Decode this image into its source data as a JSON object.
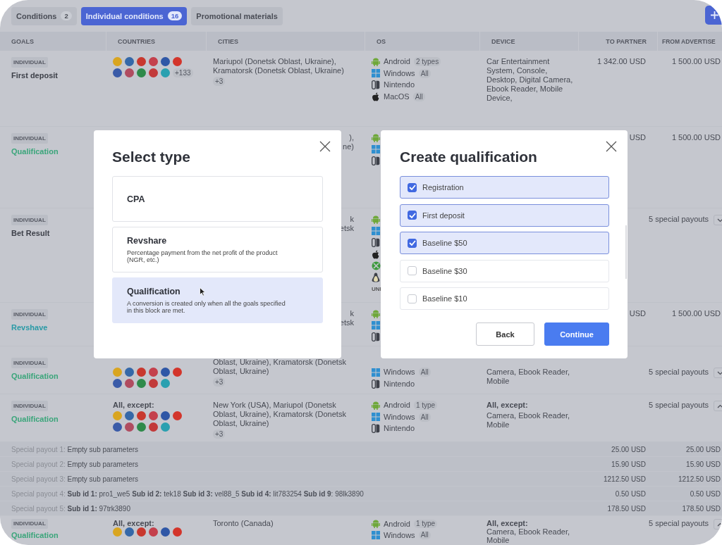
{
  "tabs": [
    {
      "label": "Conditions",
      "count": "2",
      "selected": false
    },
    {
      "label": "Individual conditions",
      "count": "16",
      "selected": true
    },
    {
      "label": "Promotional materials",
      "selected": false
    }
  ],
  "table": {
    "columns": [
      "GOALS",
      "COUNTRIES",
      "CITIES",
      "OS",
      "DEVICE",
      "TO PARTNER",
      "FROM ADVERTISE"
    ],
    "rows": [
      {
        "badge": "INDIVIDUAL",
        "goal": {
          "name": "First deposit",
          "color": "#3d4049"
        },
        "countries": {
          "flags": [
            {
              "color": "#d9a520"
            },
            {
              "color": "#3568a8"
            },
            {
              "color": "#c8382e"
            },
            {
              "color": "#c4404c"
            },
            {
              "color": "#2f57a6"
            },
            {
              "color": "#d3352b"
            },
            {
              "color": "#3a5ba8"
            },
            {
              "color": "#b04c60"
            },
            {
              "color": "#2f8a4a"
            },
            {
              "color": "#c23a3a"
            },
            {
              "color": "#2aa0b0"
            }
          ],
          "more": "+133"
        },
        "cities": {
          "kind": "full",
          "text": "Mariupol (Donetsk Oblast, Ukraine), Kramatorsk (Donetsk Oblast, Ukraine)",
          "more": "+3"
        },
        "os": [
          {
            "kind": "android",
            "name": "Android",
            "tag": "2 types"
          },
          {
            "kind": "windows",
            "name": "Windows",
            "tag": "All"
          },
          {
            "kind": "nintendo",
            "name": "Nintendo"
          },
          {
            "kind": "apple",
            "name": "MacOS",
            "tag": "All"
          }
        ],
        "device": {
          "text": "Car Entertainment System, Console, Desktop, Digital Camera, Ebook Reader, Mobile Device,"
        },
        "to_partner": "1 342.00 USD",
        "from_advertiser": "1 500.00 USD"
      },
      {
        "badge": "INDIVIDUAL",
        "goal": {
          "name": "Qualification",
          "color": "#3aa57a"
        },
        "cities": {
          "kind": "partial",
          "lines": [
            "),",
            "ne)"
          ]
        },
        "os": [
          {
            "kind": "android"
          },
          {
            "kind": "windows"
          },
          {
            "kind": "nintendo"
          }
        ],
        "to_partner": "USD",
        "from_advertiser": "1 500.00 USD"
      },
      {
        "badge": "INDIVIDUAL",
        "goal": {
          "name": "Bet Result",
          "color": "#3d4049"
        },
        "cities": {
          "kind": "partial",
          "lines": [
            "k",
            "etsk"
          ]
        },
        "os": [
          {
            "kind": "android"
          },
          {
            "kind": "windows"
          },
          {
            "kind": "nintendo"
          },
          {
            "kind": "apple"
          },
          {
            "kind": "xbox"
          },
          {
            "kind": "linux"
          },
          {
            "kind": "unix",
            "name": "UNI"
          }
        ],
        "payouts": {
          "text": "5 special payouts",
          "expanded": false
        }
      },
      {
        "badge": "INDIVIDUAL",
        "goal": {
          "name": "Revshave",
          "color": "#2a9aa6"
        },
        "cities": {
          "kind": "partial",
          "lines": [
            "k",
            "etsk"
          ]
        },
        "os": [
          {
            "kind": "android"
          },
          {
            "kind": "windows"
          },
          {
            "kind": "nintendo"
          }
        ],
        "to_partner": "USD",
        "from_advertiser": "1 500.00 USD"
      },
      {
        "badge": "INDIVIDUAL",
        "goal": {
          "name": "Qualification",
          "color": "#3aa57a"
        },
        "countries": {
          "flags": [
            {
              "color": "#d9a520"
            },
            {
              "color": "#3568a8"
            },
            {
              "color": "#c8382e"
            },
            {
              "color": "#c4404c"
            },
            {
              "color": "#2f57a6"
            },
            {
              "color": "#d3352b"
            },
            {
              "color": "#3a5ba8"
            },
            {
              "color": "#b04c60"
            },
            {
              "color": "#2f8a4a"
            },
            {
              "color": "#c23a3a"
            },
            {
              "color": "#2aa0b0"
            }
          ]
        },
        "cities": {
          "kind": "full",
          "text": "Oblast, Ukraine), Kramatorsk (Donetsk Oblast, Ukraine)",
          "more": "+3"
        },
        "os": [
          {
            "kind": "windows",
            "name": "Windows",
            "tag": "All"
          },
          {
            "kind": "nintendo",
            "name": "Nintendo"
          }
        ],
        "device": {
          "text": "Camera, Ebook Reader, Mobile"
        },
        "payouts": {
          "text": "5 special payouts",
          "expanded": false
        }
      },
      {
        "badge": "INDIVIDUAL",
        "goal": {
          "name": "Qualification",
          "color": "#3aa57a"
        },
        "countries": {
          "label": "All, except:",
          "flags": [
            {
              "color": "#d9a520"
            },
            {
              "color": "#3568a8"
            },
            {
              "color": "#c8382e"
            },
            {
              "color": "#c4404c"
            },
            {
              "color": "#2f57a6"
            },
            {
              "color": "#d3352b"
            },
            {
              "color": "#3a5ba8"
            },
            {
              "color": "#b04c60"
            },
            {
              "color": "#2f8a4a"
            },
            {
              "color": "#c23a3a"
            },
            {
              "color": "#2aa0b0"
            }
          ]
        },
        "cities": {
          "kind": "full",
          "text": "New York (USA), Mariupol (Donetsk Oblast, Ukraine), Kramatorsk (Donetsk Oblast, Ukraine)",
          "more": "+3"
        },
        "os": [
          {
            "kind": "android",
            "name": "Android",
            "tag": "1 type"
          },
          {
            "kind": "windows",
            "name": "Windows",
            "tag": "All"
          },
          {
            "kind": "nintendo",
            "name": "Nintendo"
          }
        ],
        "device": {
          "label": "All, except:",
          "text": "Camera, Ebook Reader, Mobile"
        },
        "payouts": {
          "text": "5 special payouts",
          "expanded": true
        },
        "special_payouts": [
          {
            "label": "Special payout 1:",
            "params": "Empty sub parameters",
            "to_partner": "25.00 USD",
            "from_advertiser": "25.00 USD"
          },
          {
            "label": "Special payout 2:",
            "params": "Empty sub parameters",
            "to_partner": "15.90 USD",
            "from_advertiser": "15.90 USD"
          },
          {
            "label": "Special payout 3:",
            "params": "Empty sub parameters",
            "to_partner": "1212.50 USD",
            "from_advertiser": "1212.50 USD"
          },
          {
            "label": "Special payout 4:",
            "params": "**Sub id 1:** pro1_we5  **Sub id 2:** tek18 **Sub id 3:** vel88_5 **Sub id 4:** lit783254 **Sub id 9**: 98lk3890",
            "to_partner": "0.50 USD",
            "from_advertiser": "0.50 USD"
          },
          {
            "label": "Special payout 5:",
            "params": "**Sub id 1:** 97trk3890",
            "to_partner": "178.50 USD",
            "from_advertiser": "178.50 USD"
          }
        ]
      },
      {
        "badge": "INDIVIDUAL",
        "goal": {
          "name": "Qualification",
          "color": "#3aa57a"
        },
        "countries": {
          "label": "All, except:",
          "flags": [
            {
              "color": "#d9a520"
            },
            {
              "color": "#3568a8"
            },
            {
              "color": "#c8382e"
            },
            {
              "color": "#c4404c"
            },
            {
              "color": "#2f57a6"
            },
            {
              "color": "#d3352b"
            }
          ]
        },
        "cities": {
          "kind": "full",
          "text": "Toronto (Canada)"
        },
        "os": [
          {
            "kind": "android",
            "name": "Android",
            "tag": "1 type"
          },
          {
            "kind": "windows",
            "name": "Windows",
            "tag": "All"
          }
        ],
        "device": {
          "label": "All, except:",
          "text": "Camera, Ebook Reader, Mobile"
        },
        "payouts": {
          "text": "5 special payouts",
          "expanded": true
        }
      }
    ]
  },
  "select_type": {
    "title": "Select type",
    "options": [
      {
        "title": "CPA",
        "selected": false
      },
      {
        "title": "Revshare",
        "description": "Percentage payment from the net profit of the product (NGR, etc.)",
        "selected": false
      },
      {
        "title": "Qualification",
        "description": "A conversion is created only when all the goals specified in this block are met.",
        "selected": true
      }
    ]
  },
  "create_qualification": {
    "title": "Create qualification",
    "options": [
      {
        "label": "Registration",
        "checked": true
      },
      {
        "label": "First deposit",
        "checked": true
      },
      {
        "label": "Baseline $50",
        "checked": true
      },
      {
        "label": "Baseline $30",
        "checked": false
      },
      {
        "label": "Baseline $10",
        "checked": false
      }
    ],
    "buttons": [
      {
        "label": "Back",
        "kind": "secondary"
      },
      {
        "label": "Continue",
        "kind": "primary"
      }
    ]
  }
}
